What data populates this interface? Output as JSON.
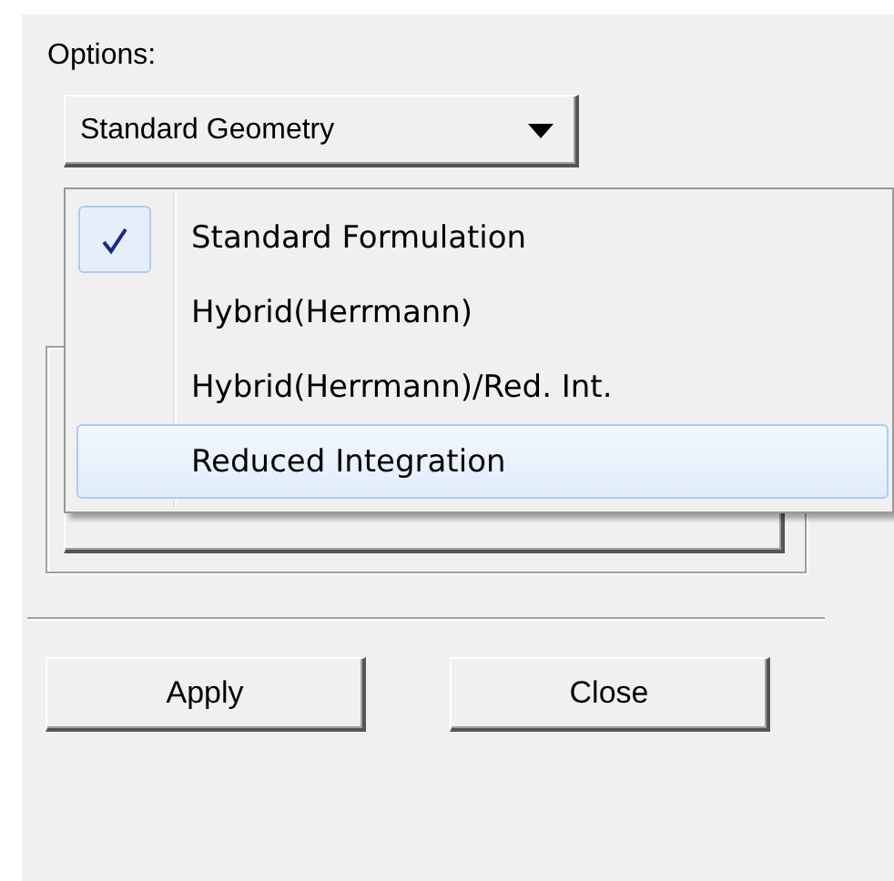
{
  "options_label": "Options:",
  "geometry_dropdown": {
    "value": "Standard Geometry"
  },
  "menu": {
    "items": [
      {
        "label": "Standard Formulation",
        "checked": true,
        "highlighted": false
      },
      {
        "label": "Hybrid(Herrmann)",
        "checked": false,
        "highlighted": false
      },
      {
        "label": "Hybrid(Herrmann)/Red. Int.",
        "checked": false,
        "highlighted": false
      },
      {
        "label": "Reduced Integration",
        "checked": false,
        "highlighted": true
      }
    ]
  },
  "buttons": [
    {
      "label": "Apply"
    },
    {
      "label": "Close"
    }
  ]
}
